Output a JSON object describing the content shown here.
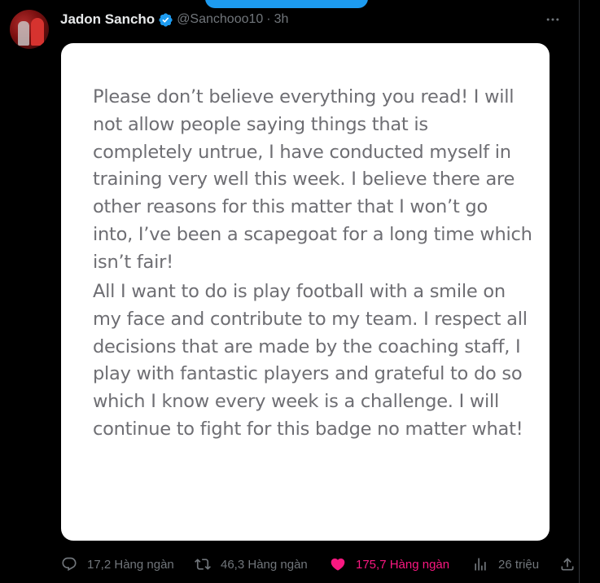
{
  "author": {
    "name": "Jadon Sancho",
    "handle": "@Sanchooo10",
    "separator": "·",
    "time": "3h",
    "verified": true
  },
  "image_text": {
    "paragraph_1": "Please don’t believe everything you read! I will not allow people saying things that is completely untrue, I have conducted myself in training very well this week. I believe there are other reasons for this matter that I won’t go into, I’ve been a scapegoat for a long time which isn’t fair!",
    "paragraph_2": "All I want to do is play football with a smile on my face and contribute to my team. I respect all decisions that are made by the coaching staff, I play with fantastic players and grateful to do so which I know every week is a challenge. I will continue to fight for this badge no matter what!"
  },
  "actions": {
    "replies": "17,2 Hàng ngàn",
    "reposts": "46,3 Hàng ngàn",
    "likes": "175,7 Hàng ngàn",
    "views": "26 triệu"
  },
  "colors": {
    "background": "#000000",
    "text_primary": "#e7e9ea",
    "text_secondary": "#71767b",
    "verified_blue": "#1d9bf0",
    "like_pink": "#f91880",
    "card_text": "#6e6e73"
  },
  "icons": [
    "avatar",
    "verified-badge-icon",
    "more-options-icon",
    "reply-icon",
    "retweet-icon",
    "like-heart-icon",
    "views-icon",
    "share-icon"
  ]
}
